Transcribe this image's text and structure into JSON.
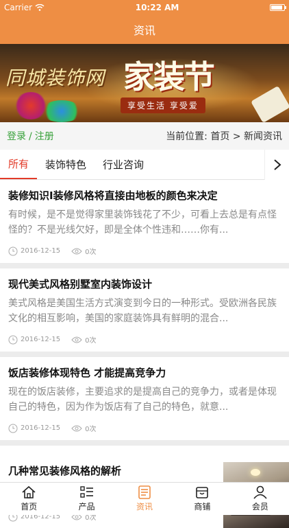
{
  "status": {
    "carrier": "Carrier",
    "time": "10:22 AM",
    "battery_level": 0.8
  },
  "header": {
    "title": "资讯"
  },
  "banner": {
    "logo": "同城装饰网",
    "headline": "家装节",
    "tagline": "享受生活 享受爱"
  },
  "locbar": {
    "login": "登录",
    "sep": "/",
    "register": "注册",
    "crumb_prefix": "当前位置:",
    "crumb_home": "首页",
    "crumb_arrow": ">",
    "crumb_current": "新闻资讯"
  },
  "tabs": [
    {
      "label": "所有",
      "active": true
    },
    {
      "label": "装饰特色",
      "active": false
    },
    {
      "label": "行业咨询",
      "active": false
    }
  ],
  "articles": [
    {
      "title": "装修知识I装修风格将直接由地板的颜色来决定",
      "desc": "有时候，是不是觉得家里装饰钱花了不少，可看上去总是有点怪怪的？不是光线欠好，即是全体个性违和……你有...",
      "date": "2016-12-15",
      "views": "0次"
    },
    {
      "title": "现代美式风格别墅室内装饰设计",
      "desc": "美式风格是美国生活方式演变到今日的一种形式。受欧洲各民族文化的相互影响，美国的家庭装饰具有鲜明的混合...",
      "date": "2016-12-15",
      "views": "0次"
    },
    {
      "title": "饭店装修体现特色 才能提高竞争力",
      "desc": "现在的饭店装修，主要追求的是提高自己的竞争力，或者是体现自己的特色，因为作为饭店有了自己的特色，就意...",
      "date": "2016-12-15",
      "views": "0次"
    },
    {
      "title": "几种常见装修风格的解析",
      "date": "2016-12-15",
      "views": "0次"
    }
  ],
  "tabbar": [
    {
      "label": "首页",
      "icon": "home-icon",
      "active": false
    },
    {
      "label": "产品",
      "icon": "list-icon",
      "active": false
    },
    {
      "label": "资讯",
      "icon": "news-icon",
      "active": true
    },
    {
      "label": "商铺",
      "icon": "store-icon",
      "active": false
    },
    {
      "label": "会员",
      "icon": "user-icon",
      "active": false
    }
  ],
  "colors": {
    "accent": "#ee8e44",
    "tab_active": "#e23a28",
    "login": "#38a13a"
  }
}
